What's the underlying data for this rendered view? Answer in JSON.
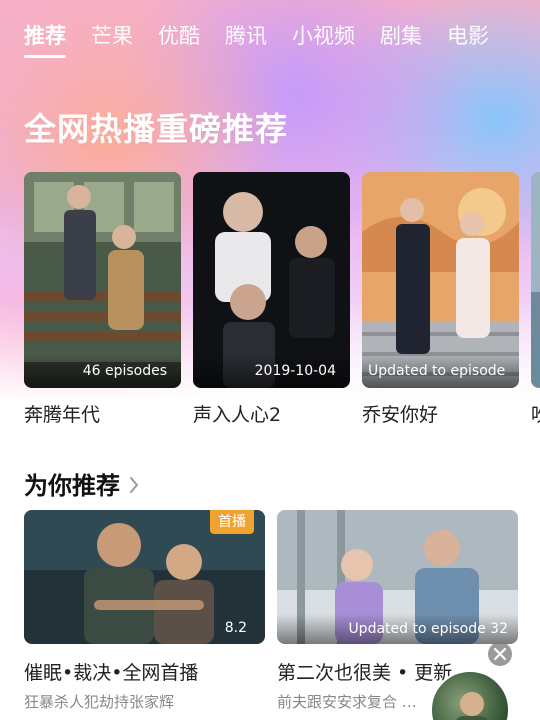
{
  "tabs": [
    {
      "label": "推荐",
      "active": true
    },
    {
      "label": "芒果"
    },
    {
      "label": "优酷"
    },
    {
      "label": "腾讯"
    },
    {
      "label": "小视频"
    },
    {
      "label": "剧集"
    },
    {
      "label": "电影"
    }
  ],
  "hero": {
    "title": "全网热播重磅推荐"
  },
  "posters": [
    {
      "title": "奔腾年代",
      "badge": "46 episodes"
    },
    {
      "title": "声入人心2",
      "badge": "2019-10-04"
    },
    {
      "title": "乔安你好",
      "badge": "Updated to episode"
    },
    {
      "title": "吹",
      "badge": ""
    }
  ],
  "recommend": {
    "title": "为你推荐",
    "cards": [
      {
        "title": "催眠•裁决•全网首播",
        "subtitle": "狂暴杀人犯劫持张家辉",
        "tag": "首播",
        "score": "8.2"
      },
      {
        "title": "第二次也很美 • 更新",
        "subtitle": "前夫跟安安求复合 …",
        "update": "Updated to episode 32"
      }
    ]
  },
  "icons": {
    "chevron": "chevron-right-icon",
    "close": "close-icon"
  },
  "colors": {
    "accent_tag": "#f1a330",
    "text_primary": "#222222",
    "text_secondary": "#888888"
  }
}
